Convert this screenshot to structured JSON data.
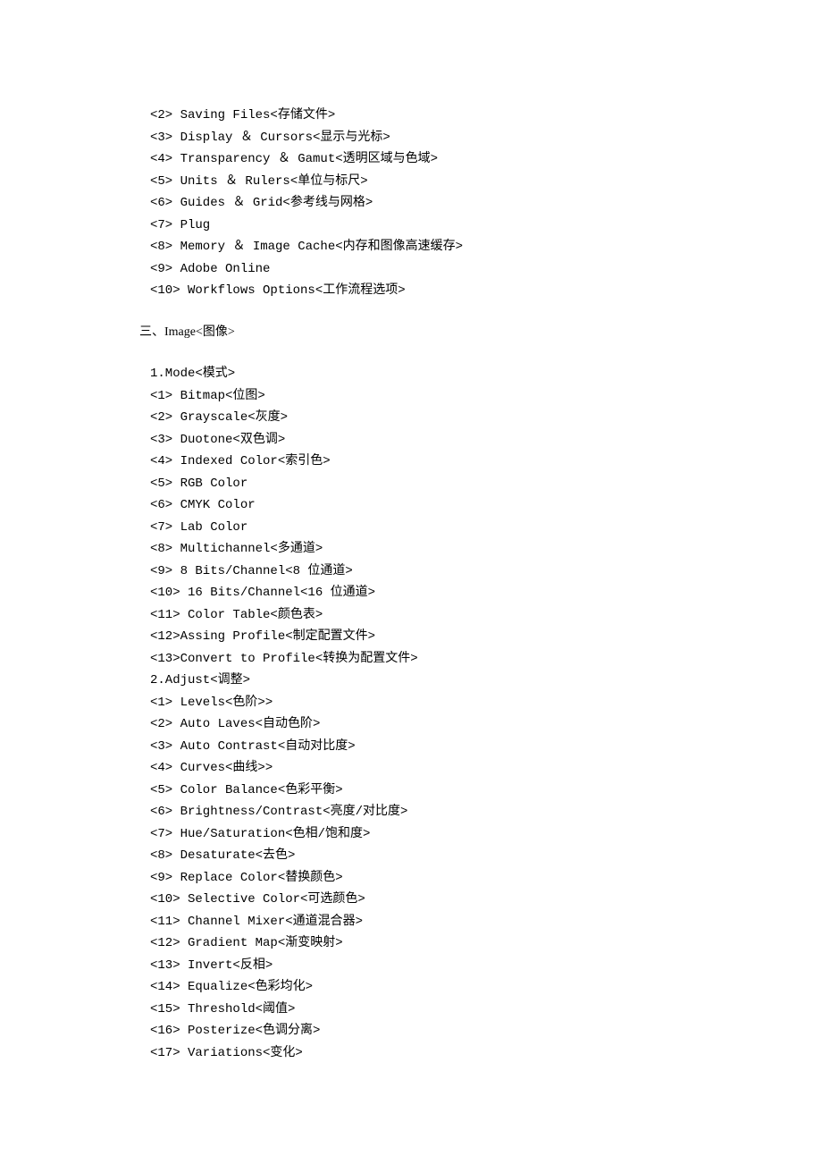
{
  "prefs": [
    "<2> Saving Files<存储文件>",
    "<3> Display ＆ Cursors<显示与光标>",
    "<4> Transparency ＆ Gamut<透明区域与色域>",
    "<5> Units ＆ Rulers<单位与标尺>",
    "<6> Guides ＆ Grid<参考线与网格>",
    "<7> Plug",
    "<8> Memory ＆ Image Cache<内存和图像高速缓存>",
    "<9> Adobe Online",
    "<10> Workflows Options<工作流程选项>"
  ],
  "section3_header": "三、Image<图像>",
  "mode_header": "1.Mode<模式>",
  "mode_items": [
    "<1> Bitmap<位图>",
    "<2> Grayscale<灰度>",
    "<3> Duotone<双色调>",
    "<4> Indexed Color<索引色>",
    "<5> RGB Color",
    "<6> CMYK Color",
    "<7> Lab Color",
    "<8> Multichannel<多通道>",
    "<9> 8 Bits/Channel<8 位通道>",
    "<10> 16 Bits/Channel<16 位通道>",
    "<11> Color Table<颜色表>",
    "<12>Assing Profile<制定配置文件>",
    "<13>Convert to Profile<转换为配置文件>"
  ],
  "adjust_header": "2.Adjust<调整>",
  "adjust_items": [
    "<1> Levels<色阶>>",
    "<2> Auto Laves<自动色阶>",
    "<3> Auto Contrast<自动对比度>",
    "<4> Curves<曲线>>",
    "<5> Color Balance<色彩平衡>",
    "<6> Brightness/Contrast<亮度/对比度>",
    "<7> Hue/Saturation<色相/饱和度>",
    "<8> Desaturate<去色>",
    "<9> Replace Color<替换颜色>",
    "<10> Selective Color<可选颜色>",
    "<11> Channel Mixer<通道混合器>",
    "<12> Gradient Map<渐变映射>",
    "<13> Invert<反相>",
    "<14> Equalize<色彩均化>",
    "<15> Threshold<阈值>",
    "<16> Posterize<色调分离>",
    "<17> Variations<变化>"
  ]
}
